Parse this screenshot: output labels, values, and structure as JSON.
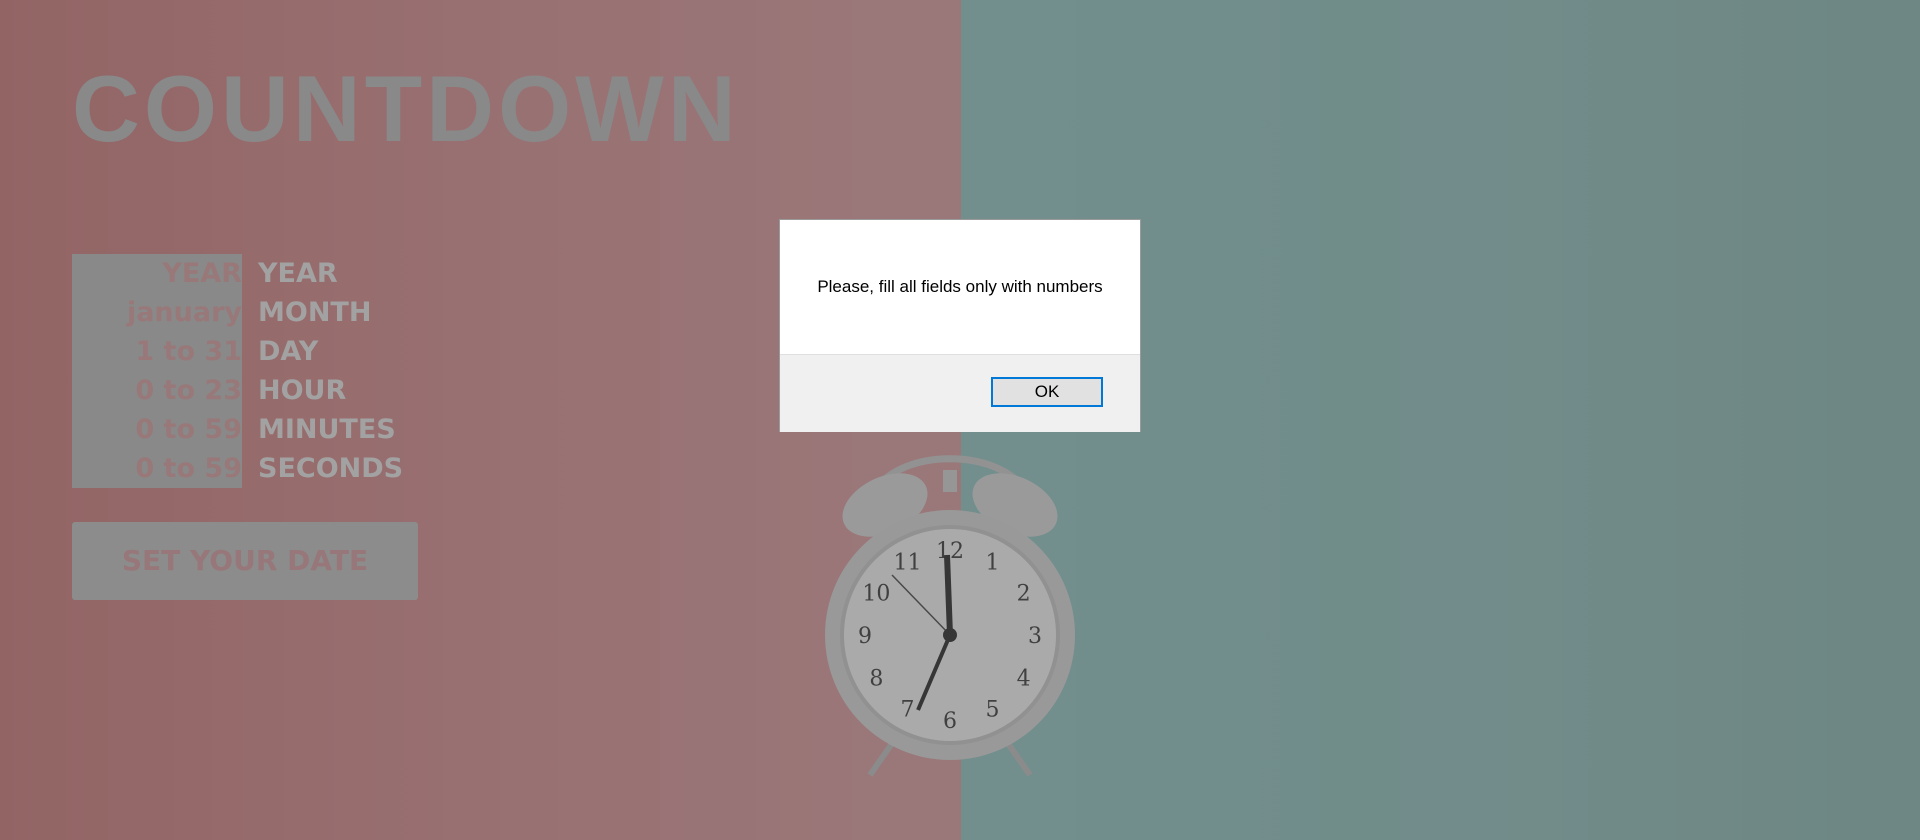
{
  "page": {
    "title": "COUNTDOWN"
  },
  "form": {
    "rows": [
      {
        "placeholder": "YEAR",
        "label": "YEAR"
      },
      {
        "placeholder": "january",
        "label": "MONTH"
      },
      {
        "placeholder": "1 to 31",
        "label": "DAY"
      },
      {
        "placeholder": "0 to 23",
        "label": "HOUR"
      },
      {
        "placeholder": "0 to 59",
        "label": "MINUTES"
      },
      {
        "placeholder": "0 to 59",
        "label": "SECONDS"
      }
    ],
    "submit_label": "SET YOUR DATE"
  },
  "clock": {
    "numerals": [
      "12",
      "1",
      "2",
      "3",
      "4",
      "5",
      "6",
      "7",
      "8",
      "9",
      "10",
      "11"
    ]
  },
  "dialog": {
    "message": "Please, fill all fields only with numbers",
    "ok_label": "OK"
  },
  "colors": {
    "left_bg": "#ca7676",
    "right_bg": "#8fc4c0",
    "dialog_button_border": "#0078d7"
  },
  "icons": {
    "clock": "alarm-clock-icon"
  }
}
